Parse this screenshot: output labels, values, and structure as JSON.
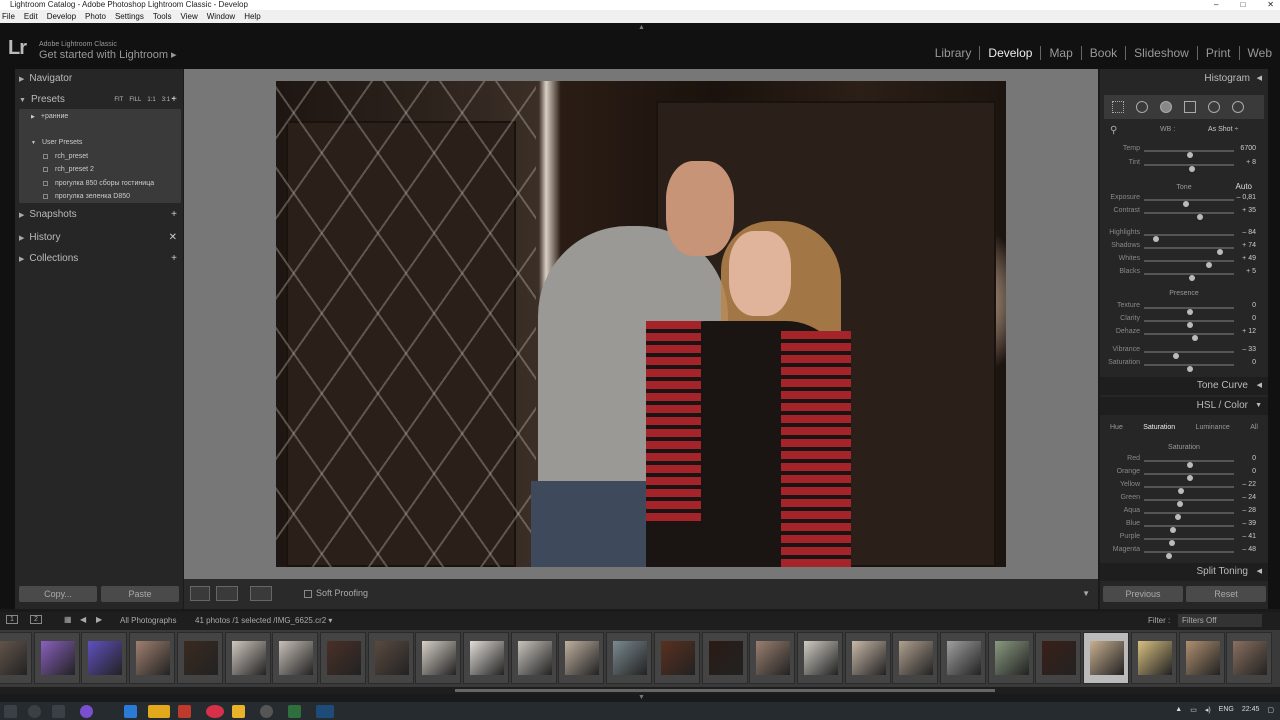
{
  "window": {
    "title": "Lightroom Catalog - Adobe Photoshop Lightroom Classic - Develop",
    "controls": [
      "–",
      "□",
      "✕"
    ]
  },
  "menu": [
    "File",
    "Edit",
    "Develop",
    "Photo",
    "Settings",
    "Tools",
    "View",
    "Window",
    "Help"
  ],
  "identity": {
    "logo": "Lr",
    "small": "Adobe Lightroom Classic",
    "get_started": "Get started with Lightroom ▸"
  },
  "modules": [
    {
      "label": "Library"
    },
    {
      "label": "Develop",
      "active": true
    },
    {
      "label": "Map"
    },
    {
      "label": "Book"
    },
    {
      "label": "Slideshow"
    },
    {
      "label": "Print"
    },
    {
      "label": "Web"
    }
  ],
  "left": {
    "navigator": {
      "label": "Navigator",
      "zoom": [
        "FIT",
        "FILL",
        "1:1",
        "3:1 ÷"
      ]
    },
    "presets": {
      "label": "Presets",
      "items": [
        "+ранние",
        "User Presets",
        "rch_preset",
        "rch_preset 2",
        "прогулка 850 сборы гостиница",
        "прогулка зеленка D850"
      ]
    },
    "snapshots": "Snapshots",
    "history": "History",
    "collections": "Collections",
    "copy": "Copy...",
    "paste": "Paste"
  },
  "toolbar": {
    "soft_proofing": "Soft Proofing"
  },
  "right": {
    "histogram": "Histogram",
    "wb": {
      "label": "WB :",
      "value": "As Shot ÷"
    },
    "basic_sliders": [
      {
        "label": "Temp",
        "value": "6700",
        "pos": 0.5
      },
      {
        "label": "Tint",
        "value": "+ 8",
        "pos": 0.52
      },
      {
        "label": "Exposure",
        "value": "– 0,81",
        "pos": 0.45
      },
      {
        "label": "Contrast",
        "value": "+ 35",
        "pos": 0.62
      },
      {
        "label": "Highlights",
        "value": "– 84",
        "pos": 0.1
      },
      {
        "label": "Shadows",
        "value": "+ 74",
        "pos": 0.85
      },
      {
        "label": "Whites",
        "value": "+ 49",
        "pos": 0.72
      },
      {
        "label": "Blacks",
        "value": "+ 5",
        "pos": 0.52
      },
      {
        "label": "Texture",
        "value": "0",
        "pos": 0.5
      },
      {
        "label": "Clarity",
        "value": "0",
        "pos": 0.5
      },
      {
        "label": "Dehaze",
        "value": "+ 12",
        "pos": 0.56
      },
      {
        "label": "Vibrance",
        "value": "– 33",
        "pos": 0.34
      },
      {
        "label": "Saturation",
        "value": "0",
        "pos": 0.5
      }
    ],
    "tone_label": "Tone",
    "auto": "Auto",
    "presence_label": "Presence",
    "tone_curve": "Tone Curve",
    "hsl": "HSL / Color",
    "hsl_tabs": [
      "Hue",
      "Saturation",
      "Luminance",
      "All"
    ],
    "hsl_section": "Saturation",
    "hsl_sliders": [
      {
        "label": "Red",
        "value": "0",
        "pos": 0.5
      },
      {
        "label": "Orange",
        "value": "0",
        "pos": 0.5
      },
      {
        "label": "Yellow",
        "value": "– 22",
        "pos": 0.39
      },
      {
        "label": "Green",
        "value": "– 24",
        "pos": 0.38
      },
      {
        "label": "Aqua",
        "value": "– 28",
        "pos": 0.36
      },
      {
        "label": "Blue",
        "value": "– 39",
        "pos": 0.3
      },
      {
        "label": "Purple",
        "value": "– 41",
        "pos": 0.29
      },
      {
        "label": "Magenta",
        "value": "– 48",
        "pos": 0.26
      }
    ],
    "split_toning": "Split Toning",
    "previous": "Previous",
    "reset": "Reset"
  },
  "filmstrip_bar": {
    "pages": [
      "1",
      "2"
    ],
    "source": "All Photographs",
    "info": "41 photos /1 selected /IMG_6625.cr2 ▾",
    "filter_label": "Filter :",
    "filter_value": "Filters Off"
  },
  "filmstrip": {
    "count": 27,
    "selected_index": 23
  },
  "taskbar": {
    "lang": "ENG",
    "time": "22:45"
  }
}
